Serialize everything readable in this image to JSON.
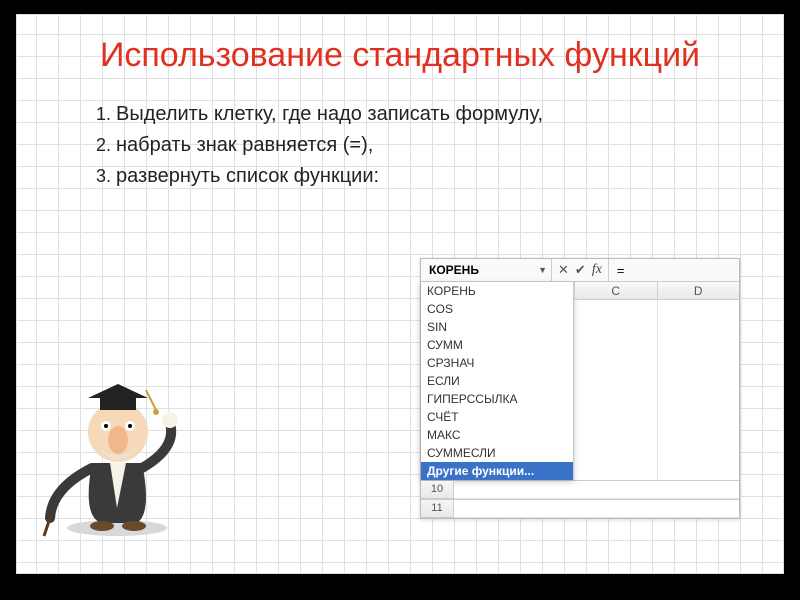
{
  "title": "Использование стандартных функций",
  "steps": [
    "Выделить клетку, где надо записать формулу,",
    "набрать знак равняется (=),",
    "развернуть список функции:"
  ],
  "excel": {
    "namebox_value": "КОРЕНЬ",
    "formula_value": "=",
    "columns": [
      "C",
      "D"
    ],
    "row_numbers": [
      "10",
      "11"
    ],
    "functions": [
      "КОРЕНЬ",
      "COS",
      "SIN",
      "СУММ",
      "СРЗНАЧ",
      "ЕСЛИ",
      "ГИПЕРССЫЛКА",
      "СЧЁТ",
      "МАКС",
      "СУММЕСЛИ",
      "Другие функции..."
    ],
    "selected_function_index": 10
  }
}
